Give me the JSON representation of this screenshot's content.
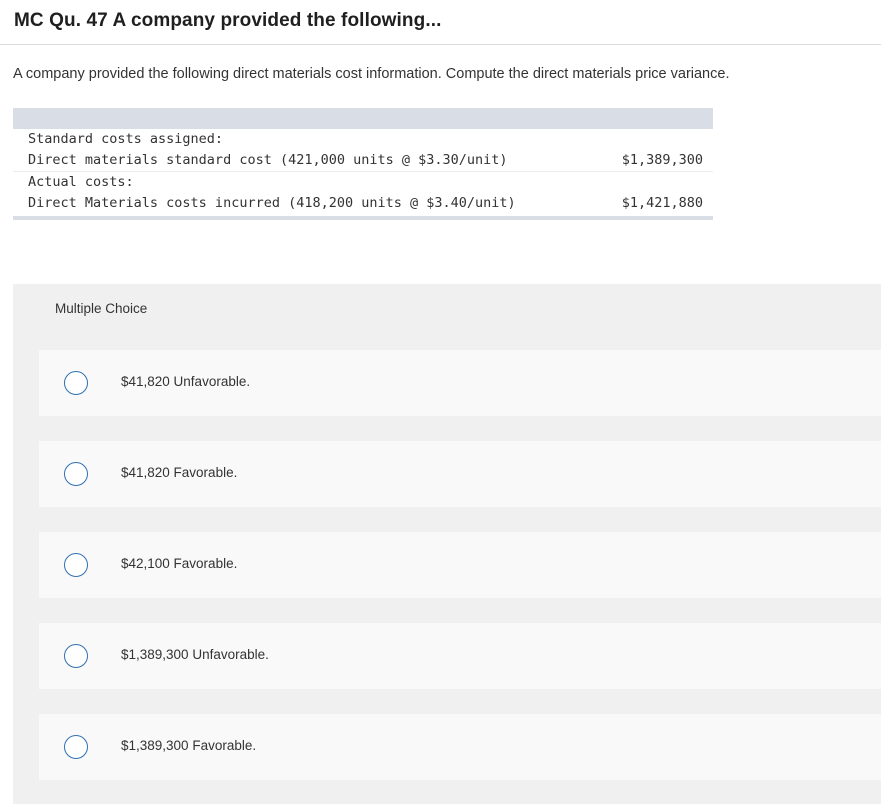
{
  "header": {
    "title": "MC Qu. 47 A company provided the following..."
  },
  "question": {
    "text": "A company provided the following direct materials cost information. Compute the direct materials price variance."
  },
  "cost_table": {
    "rows": [
      {
        "label": "Standard costs assigned:",
        "amount": ""
      },
      {
        "label": "Direct materials standard cost (421,000 units @ $3.30/unit)",
        "amount": "$1,389,300"
      },
      {
        "label": "Actual costs:",
        "amount": ""
      },
      {
        "label": "Direct Materials costs incurred (418,200 units @ $3.40/unit)",
        "amount": "$1,421,880"
      }
    ]
  },
  "multiple_choice": {
    "header": "Multiple Choice",
    "options": [
      {
        "label": "$41,820 Unfavorable."
      },
      {
        "label": "$41,820 Favorable."
      },
      {
        "label": "$42,100 Favorable."
      },
      {
        "label": "$1,389,300 Unfavorable."
      },
      {
        "label": "$1,389,300 Favorable."
      }
    ]
  },
  "colors": {
    "radio_border": "#2f6fb3",
    "table_band": "#d9dde6",
    "panel_bg": "#f0f0f0",
    "choice_bg": "#f9f9f9"
  }
}
